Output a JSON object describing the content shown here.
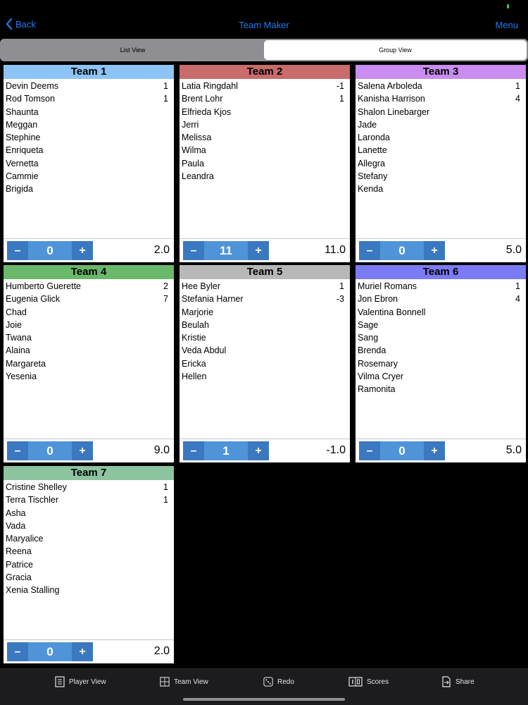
{
  "nav": {
    "back_label": "Back",
    "title": "Team Maker",
    "menu_label": "Menu"
  },
  "segments": [
    {
      "label": "List View",
      "active": false
    },
    {
      "label": "Group View",
      "active": true
    }
  ],
  "stepper_labels": {
    "minus": "–",
    "plus": "+"
  },
  "teams": [
    {
      "name": "Team 1",
      "color": "#8ec4f5",
      "counter": "0",
      "score": "2.0",
      "players": [
        {
          "name": "Devin Deems",
          "value": "1"
        },
        {
          "name": "Rod Tomson",
          "value": "1"
        },
        {
          "name": "Shaunta",
          "value": ""
        },
        {
          "name": "Meggan",
          "value": ""
        },
        {
          "name": "Stephine",
          "value": ""
        },
        {
          "name": "Enriqueta",
          "value": ""
        },
        {
          "name": "Vernetta",
          "value": ""
        },
        {
          "name": "Cammie",
          "value": ""
        },
        {
          "name": "Brigida",
          "value": ""
        }
      ]
    },
    {
      "name": "Team 2",
      "color": "#c86c6c",
      "counter": "11",
      "score": "11.0",
      "players": [
        {
          "name": "Latia Ringdahl",
          "value": "-1"
        },
        {
          "name": "Brent Lohr",
          "value": "1"
        },
        {
          "name": "Elfrieda Kjos",
          "value": ""
        },
        {
          "name": "Jerri",
          "value": ""
        },
        {
          "name": "Melissa",
          "value": ""
        },
        {
          "name": "Wilma",
          "value": ""
        },
        {
          "name": "Paula",
          "value": ""
        },
        {
          "name": "Leandra",
          "value": ""
        }
      ]
    },
    {
      "name": "Team 3",
      "color": "#c98cf0",
      "counter": "0",
      "score": "5.0",
      "players": [
        {
          "name": "Salena Arboleda",
          "value": "1"
        },
        {
          "name": "Kanisha Harrison",
          "value": "4"
        },
        {
          "name": "Shalon Linebarger",
          "value": ""
        },
        {
          "name": "Jade",
          "value": ""
        },
        {
          "name": "Laronda",
          "value": ""
        },
        {
          "name": "Lanette",
          "value": ""
        },
        {
          "name": "Allegra",
          "value": ""
        },
        {
          "name": "Stefany",
          "value": ""
        },
        {
          "name": "Kenda",
          "value": ""
        }
      ]
    },
    {
      "name": "Team 4",
      "color": "#6ab86a",
      "counter": "0",
      "score": "9.0",
      "players": [
        {
          "name": "Humberto Guerette",
          "value": "2"
        },
        {
          "name": "Eugenia Glick",
          "value": "7"
        },
        {
          "name": "Chad",
          "value": ""
        },
        {
          "name": "Joie",
          "value": ""
        },
        {
          "name": "Twana",
          "value": ""
        },
        {
          "name": "Alaina",
          "value": ""
        },
        {
          "name": "Margareta",
          "value": ""
        },
        {
          "name": "Yesenia",
          "value": ""
        }
      ]
    },
    {
      "name": "Team 5",
      "color": "#b8b8b8",
      "counter": "1",
      "score": "-1.0",
      "players": [
        {
          "name": "Hee Byler",
          "value": "1"
        },
        {
          "name": "Stefania Harner",
          "value": "-3"
        },
        {
          "name": "Marjorie",
          "value": ""
        },
        {
          "name": "Beulah",
          "value": ""
        },
        {
          "name": "Kristie",
          "value": ""
        },
        {
          "name": "Veda Abdul",
          "value": ""
        },
        {
          "name": "Ericka",
          "value": ""
        },
        {
          "name": "Hellen",
          "value": ""
        }
      ]
    },
    {
      "name": "Team 6",
      "color": "#7b7cf5",
      "counter": "0",
      "score": "5.0",
      "players": [
        {
          "name": "Muriel Romans",
          "value": "1"
        },
        {
          "name": "Jon Ebron",
          "value": "4"
        },
        {
          "name": "Valentina Bonnell",
          "value": ""
        },
        {
          "name": "Sage",
          "value": ""
        },
        {
          "name": "Sang",
          "value": ""
        },
        {
          "name": "Brenda",
          "value": ""
        },
        {
          "name": "Rosemary",
          "value": ""
        },
        {
          "name": "Vilma Cryer",
          "value": ""
        },
        {
          "name": "Ramonita",
          "value": ""
        }
      ]
    },
    {
      "name": "Team 7",
      "color": "#8cc4a0",
      "counter": "0",
      "score": "2.0",
      "players": [
        {
          "name": "Cristine Shelley",
          "value": "1"
        },
        {
          "name": "Terra Tischler",
          "value": "1"
        },
        {
          "name": "Asha",
          "value": ""
        },
        {
          "name": "Vada",
          "value": ""
        },
        {
          "name": "Maryalice",
          "value": ""
        },
        {
          "name": "Reena",
          "value": ""
        },
        {
          "name": "Patrice",
          "value": ""
        },
        {
          "name": "Gracia",
          "value": ""
        },
        {
          "name": "Xenia Stalling",
          "value": ""
        }
      ]
    }
  ],
  "tabbar": [
    {
      "label": "Player View",
      "icon": "player-view-icon"
    },
    {
      "label": "Team View",
      "icon": "team-view-icon"
    },
    {
      "label": "Redo",
      "icon": "dice-icon"
    },
    {
      "label": "Scores",
      "icon": "scores-icon"
    },
    {
      "label": "Share",
      "icon": "share-icon"
    }
  ]
}
